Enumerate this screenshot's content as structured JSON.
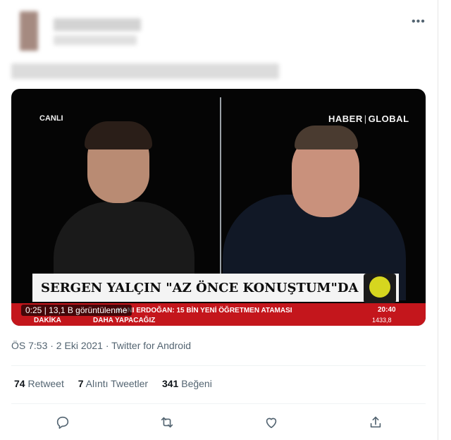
{
  "tweet": {
    "more_label": "•••",
    "timestamp": "ÖS 7:53 · 2 Eki 2021 · Twitter for Android"
  },
  "video": {
    "live_label": "CANLI",
    "brand_left": "HABER",
    "brand_right": "GLOBAL",
    "headline": "SERGEN YALÇIN \"AZ ÖNCE KONUŞTUM\"DA",
    "ticker_line1": "KANI ERDOĞAN: 15 BİN YENİ ÖĞRETMEN ATAMASI",
    "ticker_line2": "DAHA YAPACAĞIZ",
    "ticker_tag": "DAKİKA",
    "clock": "20:40",
    "index": "1433,8",
    "time": "0:25",
    "views": "13,1 B görüntülenme"
  },
  "stats": {
    "retweets_count": "74",
    "retweets_label": "Retweet",
    "quotes_count": "7",
    "quotes_label": "Alıntı Tweetler",
    "likes_count": "341",
    "likes_label": "Beğeni"
  },
  "icons": {
    "reply": "reply-icon",
    "retweet": "retweet-icon",
    "like": "heart-icon",
    "share": "share-icon"
  }
}
